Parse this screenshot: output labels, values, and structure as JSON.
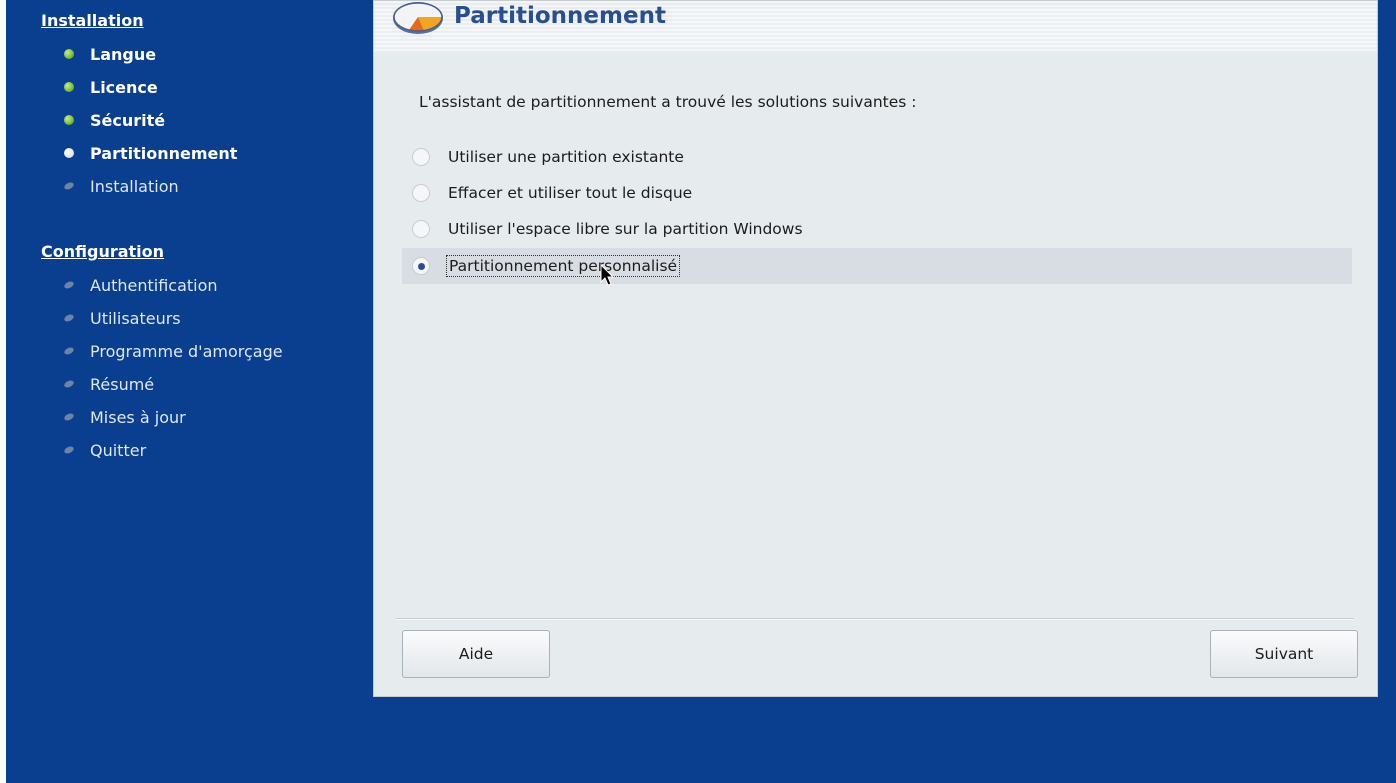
{
  "sidebar": {
    "installation": {
      "title": "Installation",
      "steps": [
        {
          "label": "Langue",
          "state": "done"
        },
        {
          "label": "Licence",
          "state": "done"
        },
        {
          "label": "Sécurité",
          "state": "done"
        },
        {
          "label": "Partitionnement",
          "state": "current"
        },
        {
          "label": "Installation",
          "state": "pending"
        }
      ]
    },
    "configuration": {
      "title": "Configuration",
      "steps": [
        {
          "label": "Authentification",
          "state": "pending"
        },
        {
          "label": "Utilisateurs",
          "state": "pending"
        },
        {
          "label": "Programme d'amorçage",
          "state": "pending"
        },
        {
          "label": "Résumé",
          "state": "pending"
        },
        {
          "label": "Mises à jour",
          "state": "pending"
        },
        {
          "label": "Quitter",
          "state": "pending"
        }
      ]
    }
  },
  "main": {
    "title": "Partitionnement",
    "intro": "L'assistant de partitionnement a trouvé les solutions suivantes :",
    "options": [
      {
        "label": "Utiliser une partition existante",
        "selected": false
      },
      {
        "label": "Effacer et utiliser tout le disque",
        "selected": false
      },
      {
        "label": "Utiliser l'espace libre sur la partition Windows",
        "selected": false
      },
      {
        "label": "Partitionnement personnalisé",
        "selected": true
      }
    ],
    "buttons": {
      "help": "Aide",
      "next": "Suivant"
    }
  },
  "colors": {
    "background": "#0a3f8f",
    "panel": "#e6ebee",
    "title": "#2a4f91",
    "done_bullet": "#3e9a12"
  },
  "icons": {
    "header": "partition-pie-icon",
    "pointer": "mouse-cursor-icon"
  }
}
